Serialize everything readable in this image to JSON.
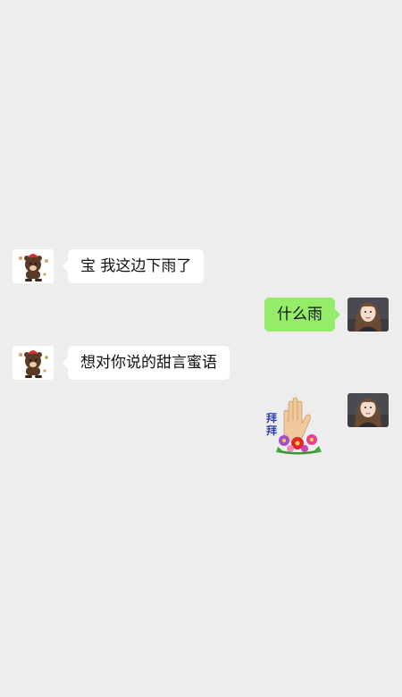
{
  "messages": [
    {
      "sender": "other",
      "avatar": "bear-avatar-icon",
      "text": "宝 我这边下雨了"
    },
    {
      "sender": "me",
      "avatar": "girl-avatar-icon",
      "text": "什么雨"
    },
    {
      "sender": "other",
      "avatar": "bear-avatar-icon",
      "text": "想对你说的甜言蜜语"
    },
    {
      "sender": "me",
      "avatar": "girl-avatar-icon",
      "sticker": "waving-hand-flowers-sticker",
      "sticker_text": [
        "拜",
        "拜"
      ]
    }
  ],
  "colors": {
    "background": "#ededed",
    "bubble_other": "#ffffff",
    "bubble_me": "#95ec69"
  }
}
